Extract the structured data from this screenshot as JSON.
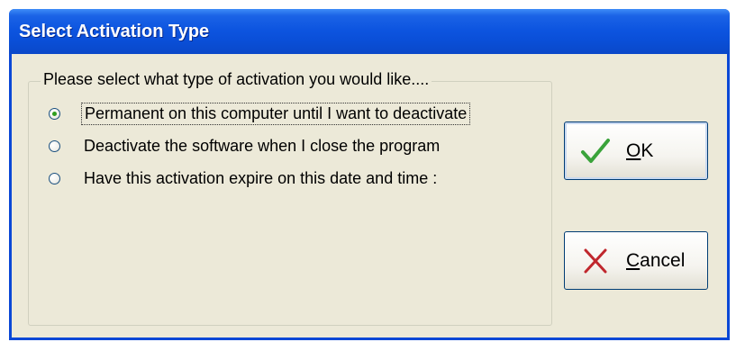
{
  "window": {
    "title": "Select Activation Type"
  },
  "group": {
    "legend": "Please select what type of activation you would like...."
  },
  "options": [
    {
      "label": "Permanent on this computer until I want to deactivate",
      "checked": true
    },
    {
      "label": "Deactivate the software when I close the program",
      "checked": false
    },
    {
      "label": "Have this activation expire on this date and time :",
      "checked": false
    }
  ],
  "buttons": {
    "ok": {
      "accel": "O",
      "rest": "K",
      "icon": "checkmark-icon"
    },
    "cancel": {
      "accel": "C",
      "rest": "ancel",
      "icon": "x-icon"
    }
  },
  "colors": {
    "titlebar": "#0a4fd8",
    "dialog_bg": "#ece9d8",
    "ok_icon": "#3aa33a",
    "cancel_icon": "#c0272d"
  }
}
